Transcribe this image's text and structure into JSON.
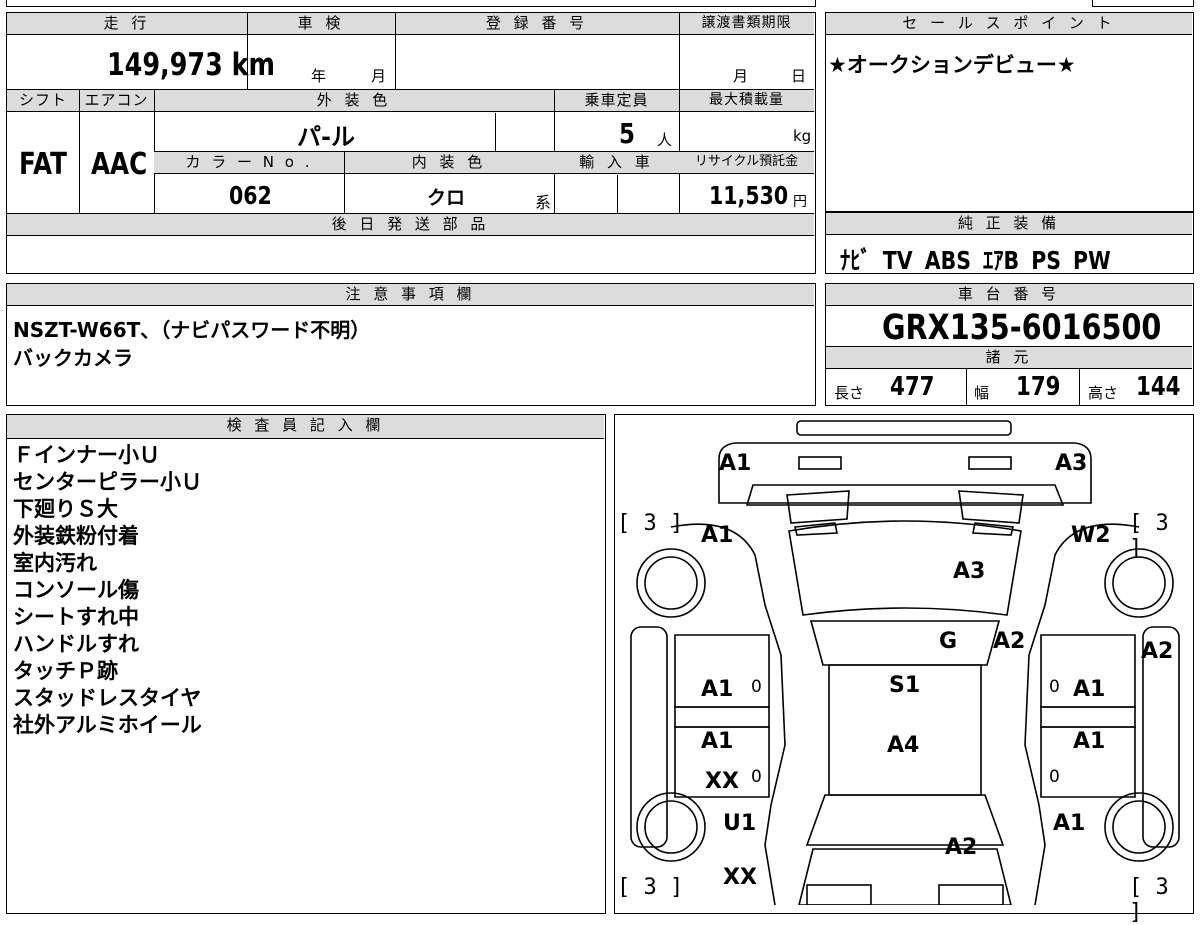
{
  "main": {
    "headers": {
      "mileage": "走 行",
      "inspection": "車 検",
      "registration": "登 録 番 号",
      "transfer_deadline": "譲渡書類期限",
      "shift": "シフト",
      "aircon": "エアコン",
      "exterior_color": "外 装 色",
      "capacity": "乗車定員",
      "max_load": "最大積載量",
      "color_no": "カ ラ ー N o .",
      "interior_color": "内 装 色",
      "import": "輸 入 車",
      "recycle": "リサイクル預託金",
      "later_parts": "後 日 発 送 部 品"
    },
    "mileage_value": "149,973 km",
    "inspection_year_unit": "年",
    "inspection_month_unit": "月",
    "transfer_month_unit": "月",
    "transfer_day_unit": "日",
    "shift_value": "FAT",
    "aircon_value": "AAC",
    "exterior_color_value": "パ-ル",
    "capacity_value": "5",
    "capacity_unit": "人",
    "max_load_unit": "kg",
    "color_no_value": "062",
    "interior_color_value": "クロ",
    "interior_color_suffix": "系",
    "recycle_value": "11,530",
    "recycle_unit": "円"
  },
  "sales": {
    "header": "セ ー ル ス ポ イ ン ト",
    "text": "★オークションデビュー★"
  },
  "equipment": {
    "header": "純 正 装 備",
    "items": "ﾅﾋﾞ TV ABS ｴｱB PS PW"
  },
  "notes": {
    "header": "注 意 事 項 欄",
    "line1": "NSZT-W66T、（ナビパスワード不明）",
    "line2": "バックカメラ"
  },
  "chassis": {
    "header": "車 台 番 号",
    "number": "GRX135-6016500"
  },
  "specs": {
    "header": "諸 元",
    "length_label": "長さ",
    "length_value": "477",
    "width_label": "幅",
    "width_value": "179",
    "height_label": "高さ",
    "height_value": "144"
  },
  "inspector": {
    "header": "検 査 員 記 入 欄",
    "lines": [
      "Ｆインナー小Ｕ",
      "センターピラー小Ｕ",
      "下廻りＳ大",
      "外装鉄粉付着",
      "室内汚れ",
      "コンソール傷",
      "シートすれ中",
      "ハンドルすれ",
      "タッチＰ跡",
      "スタッドレスタイヤ",
      "社外アルミホイール"
    ]
  },
  "diagram": {
    "grades": [
      "A1",
      "A3",
      "A1",
      "W2",
      "A3",
      "G",
      "A2",
      "A2",
      "A1",
      "S1",
      "A1",
      "A1",
      "A4",
      "A1",
      "XX",
      "U1",
      "A1",
      "A2",
      "XX"
    ],
    "tire_marks": [
      "[ 3 ]",
      "[ 3 ]",
      "[ 3 ]",
      "[ 3 ]"
    ],
    "zero_marks": [
      "0",
      "0",
      "0",
      "0"
    ]
  }
}
